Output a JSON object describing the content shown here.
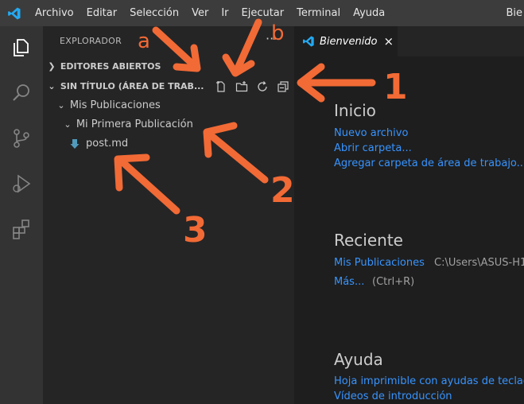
{
  "menubar": {
    "items": [
      "Archivo",
      "Editar",
      "Selección",
      "Ver",
      "Ir",
      "Ejecutar",
      "Terminal",
      "Ayuda"
    ],
    "title_right": "Bie"
  },
  "sidebar": {
    "title": "EXPLORADOR",
    "more": "···",
    "open_editors": "EDITORES ABIERTOS",
    "workspace": "SIN TÍTULO (ÁREA DE TRAB...",
    "tree": {
      "folder1": "Mis Publicaciones",
      "folder2": "Mi Primera Publicación",
      "file": "post.md"
    }
  },
  "tab": {
    "label": "Bienvenido",
    "close": "×"
  },
  "welcome": {
    "start_title": "Inicio",
    "start_links": [
      "Nuevo archivo",
      "Abrir carpeta...",
      "Agregar carpeta de área de trabajo..."
    ],
    "recent_title": "Reciente",
    "recent_item": "Mis Publicaciones",
    "recent_path": "C:\\Users\\ASUS-H1",
    "more_link": "Más...",
    "more_hint": "(Ctrl+R)",
    "help_title": "Ayuda",
    "help_links": [
      "Hoja imprimible con ayudas de teclad",
      "Vídeos de introducción"
    ]
  },
  "annotations": {
    "label_a": "a",
    "label_b": "b",
    "label_1": "1",
    "label_2": "2",
    "label_3": "3",
    "color": "#f26a35"
  },
  "colors": {
    "accent": "#3794ff",
    "vscode_blue": "#23a9f2",
    "file_icon": "#519aba"
  }
}
